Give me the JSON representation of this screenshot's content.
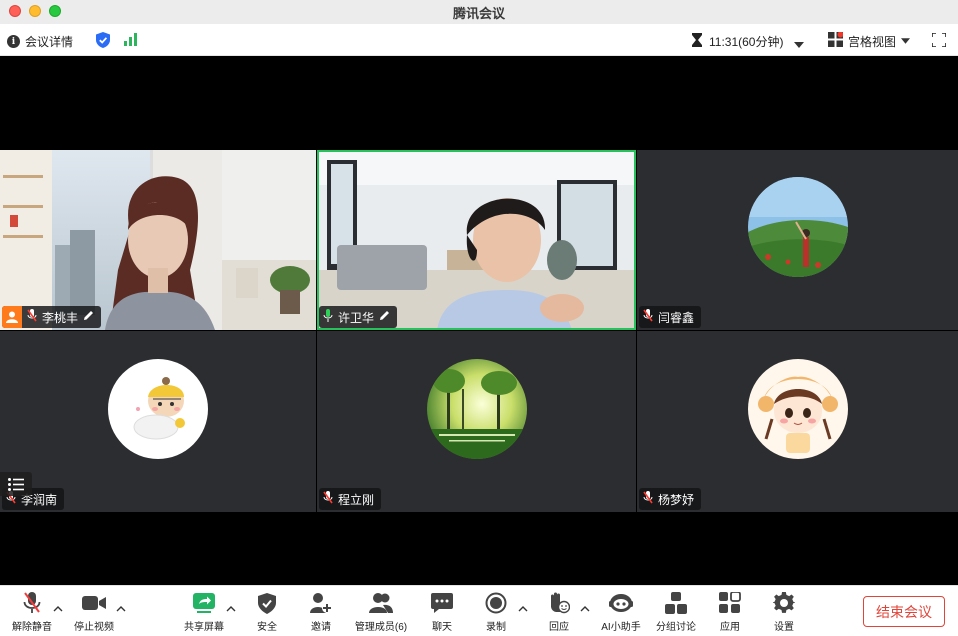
{
  "window": {
    "title": "腾讯会议"
  },
  "infobar": {
    "details_label": "会议详情",
    "timer": "11:31(60分钟)",
    "view_mode": "宫格视图"
  },
  "participants": [
    {
      "name": "李桃丰",
      "type": "video",
      "is_host": true
    },
    {
      "name": "许卫华",
      "type": "video",
      "speaking": true
    },
    {
      "name": "闫睿鑫",
      "type": "avatar"
    },
    {
      "name": "李润南",
      "type": "avatar"
    },
    {
      "name": "程立刚",
      "type": "avatar"
    },
    {
      "name": "杨梦妤",
      "type": "avatar"
    }
  ],
  "toolbar": {
    "unmute": "解除静音",
    "stop_video": "停止视频",
    "share_screen": "共享屏幕",
    "security": "安全",
    "invite": "邀请",
    "manage_members": "管理成员(6)",
    "chat": "聊天",
    "record": "录制",
    "react": "回应",
    "ai_assistant": "AI小助手",
    "breakout": "分组讨论",
    "apps": "应用",
    "settings": "设置",
    "end_meeting": "结束会议"
  }
}
